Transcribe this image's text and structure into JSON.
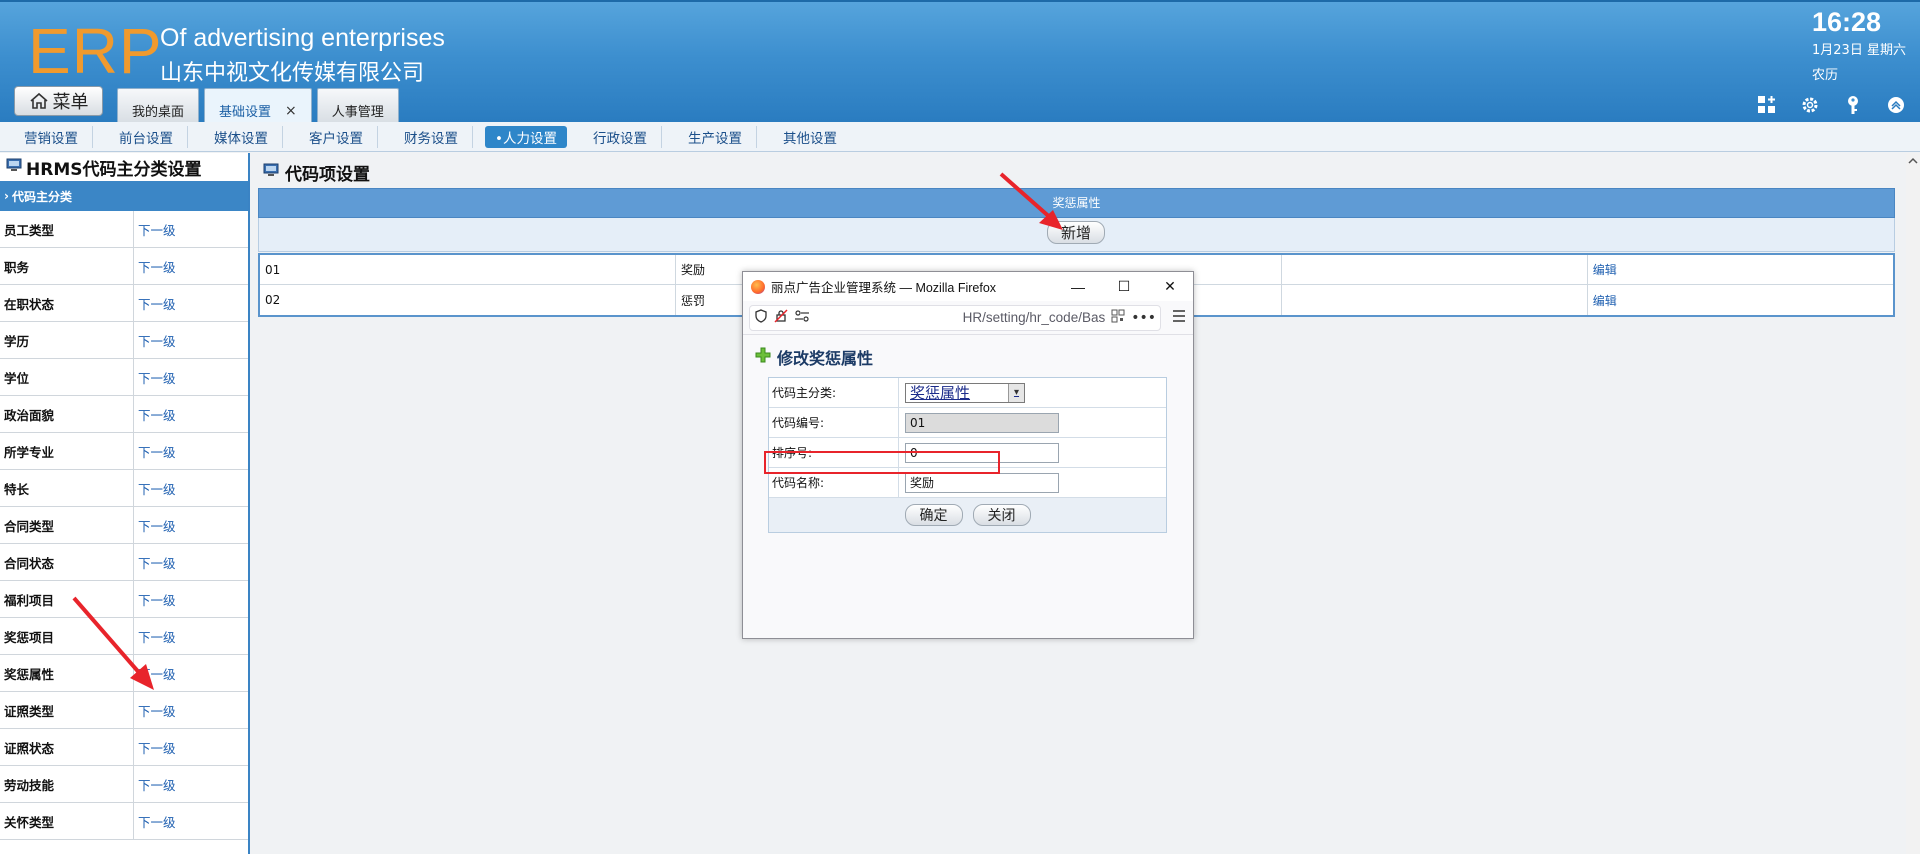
{
  "header": {
    "logo": "ERP",
    "brand_en": "Of advertising enterprises",
    "brand_cn": "山东中视文化传媒有限公司",
    "menu_label": "菜单",
    "clock": "16:28",
    "date": "1月23日 星期六",
    "lunar": "农历",
    "tabs": [
      {
        "label": "我的桌面"
      },
      {
        "label": "基础设置",
        "close": "×"
      },
      {
        "label": "人事管理"
      }
    ],
    "icons": [
      "grid-add-icon",
      "gear-icon",
      "key-icon",
      "chevron-up-icon"
    ]
  },
  "submenu": [
    "营销设置",
    "前台设置",
    "媒体设置",
    "客户设置",
    "财务设置",
    "•人力设置",
    "行政设置",
    "生产设置",
    "其他设置"
  ],
  "left_panel": {
    "title": "HRMS代码主分类设置",
    "head": "代码主分类",
    "link_label": "下一级",
    "items": [
      "员工类型",
      "职务",
      "在职状态",
      "学历",
      "学位",
      "政治面貌",
      "所学专业",
      "特长",
      "合同类型",
      "合同状态",
      "福利项目",
      "奖惩项目",
      "奖惩属性",
      "证照类型",
      "证照状态",
      "劳动技能",
      "关怀类型"
    ]
  },
  "main": {
    "title": "代码项设置",
    "grid_header": "奖惩属性",
    "add_label": "新增",
    "rows": [
      {
        "code": "01",
        "name": "奖励",
        "col3": "",
        "action": "编辑"
      },
      {
        "code": "02",
        "name": "惩罚",
        "col3": "",
        "action": "编辑"
      }
    ]
  },
  "popup": {
    "window_title": "丽点广告企业管理系统 — Mozilla Firefox",
    "url": "HR/setting/hr_code/Bas",
    "dialog_title": "修改奖惩属性",
    "fields": {
      "category_label": "代码主分类:",
      "category_value": "奖惩属性",
      "code_label": "代码编号:",
      "code_value": "01",
      "order_label": "排序号:",
      "order_value": "0",
      "name_label": "代码名称:",
      "name_value": "奖励"
    },
    "ok_label": "确定",
    "close_label": "关闭",
    "win_min": "—",
    "win_max": "☐",
    "win_close": "✕"
  },
  "colors": {
    "header_blue": "#3d8fcf",
    "accent_orange": "#f09a2e",
    "link_blue": "#1e5fb0",
    "highlight_red": "#e8242b"
  }
}
